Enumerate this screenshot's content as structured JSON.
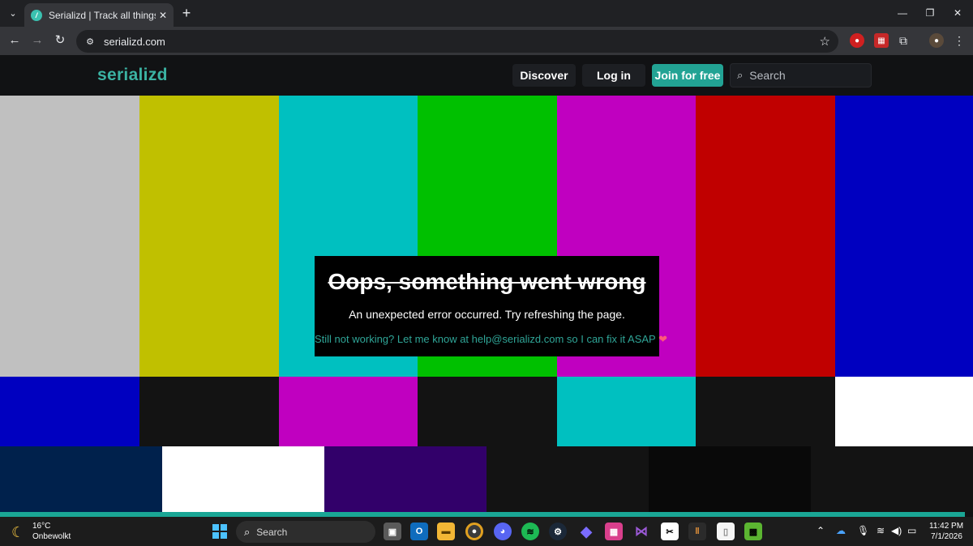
{
  "browser": {
    "tab_title": "Serializd | Track all things TV",
    "url": "serializd.com",
    "new_tab": "+",
    "tab_close": "✕"
  },
  "site": {
    "logo": "serializd",
    "nav": {
      "discover": "Discover",
      "login": "Log in",
      "join": "Join for free"
    },
    "search_placeholder": "Search"
  },
  "error": {
    "title": "Oops, something went wrong",
    "message": "An unexpected error occurred. Try refreshing the page.",
    "help": "Still not working? Let me know at help@serializd.com so I can fix it ASAP",
    "heart": "❤"
  },
  "colors": {
    "top_bars": [
      "#c0c0c0",
      "#c0c000",
      "#00c0c0",
      "#00c000",
      "#c000c0",
      "#c00000",
      "#0000c0"
    ],
    "mid_bars": [
      "#0000c0",
      "#131313",
      "#c000c0",
      "#131313",
      "#00c0c0",
      "#131313",
      "#ffffff"
    ],
    "bottom_bars": [
      "#00214c",
      "#ffffff",
      "#32006a",
      "#131313",
      "#090909",
      "#131313"
    ],
    "brand_teal": "#3bb3a3"
  },
  "taskbar": {
    "weather_temp": "16°C",
    "weather_desc": "Onbewolkt",
    "search_label": "Search",
    "time": "11:42 PM",
    "date": "7/1/2026"
  }
}
